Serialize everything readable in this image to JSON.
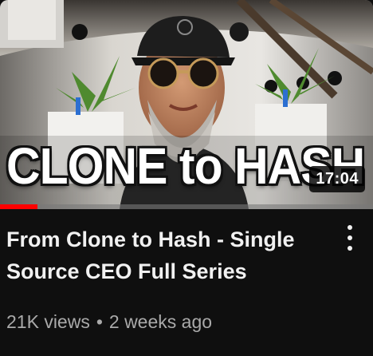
{
  "video": {
    "thumbnail_text": "CLONE to HASH",
    "duration": "17:04",
    "watch_progress": 0.1,
    "title": "From Clone to Hash - Single Source CEO Full Series",
    "views": "21K views",
    "separator": "•",
    "age": "2 weeks ago"
  },
  "colors": {
    "background": "#0f0f0f",
    "progress": "#ff0000",
    "title": "#f1f1f1",
    "meta": "#aaaaaa"
  },
  "icons": {
    "menu": "more-vert-icon"
  }
}
